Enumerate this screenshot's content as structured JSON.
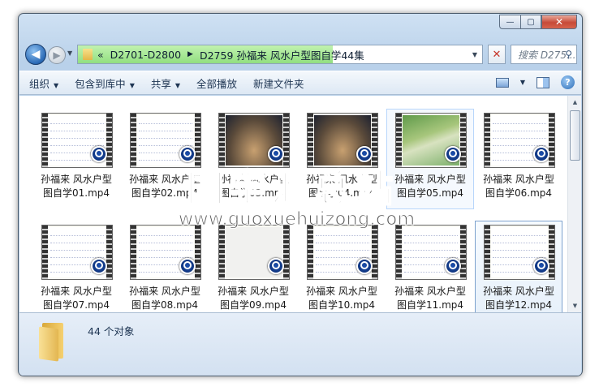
{
  "window": {
    "caption_buttons": {
      "minimize": "—",
      "maximize": "▢",
      "close": "✕"
    }
  },
  "nav": {
    "back_icon": "◀",
    "forward_icon": "▶",
    "address": {
      "chevron": "«",
      "segment1": "D2701-D2800",
      "sep": "▶",
      "segment2": "D2759 孙福来 风水户型图自学44集",
      "progress_percent": 63
    },
    "refresh_icon": "✕",
    "search_placeholder": "搜索 D275...",
    "search_icon": "⚲"
  },
  "toolbar": {
    "organize": "组织",
    "include_library": "包含到库中",
    "share": "共享",
    "play_all": "全部播放",
    "new_folder": "新建文件夹",
    "help": "?"
  },
  "files": [
    {
      "line1": "孙福来 风水户型",
      "line2": "图自学01.mp4",
      "thumb": "doc"
    },
    {
      "line1": "孙福来 风水户型",
      "line2": "图自学02.mp4",
      "thumb": "doc"
    },
    {
      "line1": "孙福来 风水户型",
      "line2": "图自学03.mp4",
      "thumb": "scene"
    },
    {
      "line1": "孙福来 风水户型",
      "line2": "图自学04.mp4",
      "thumb": "scene"
    },
    {
      "line1": "孙福来 风水户型",
      "line2": "图自学05.mp4",
      "thumb": "green"
    },
    {
      "line1": "孙福来 风水户型",
      "line2": "图自学06.mp4",
      "thumb": "doc"
    },
    {
      "line1": "孙福来 风水户型",
      "line2": "图自学07.mp4",
      "thumb": "doc"
    },
    {
      "line1": "孙福来 风水户型",
      "line2": "图自学08.mp4",
      "thumb": "doc"
    },
    {
      "line1": "孙福来 风水户型",
      "line2": "图自学09.mp4",
      "thumb": "gray"
    },
    {
      "line1": "孙福来 风水户型",
      "line2": "图自学10.mp4",
      "thumb": "doc"
    },
    {
      "line1": "孙福来 风水户型",
      "line2": "图自学11.mp4",
      "thumb": "doc"
    },
    {
      "line1": "孙福来 风水户型",
      "line2": "图自学12.mp4",
      "thumb": "doc"
    }
  ],
  "details": {
    "count": "44 个对象"
  },
  "watermark": {
    "title": "国学汇总站",
    "url": "www.guoxuehuizong.com"
  }
}
